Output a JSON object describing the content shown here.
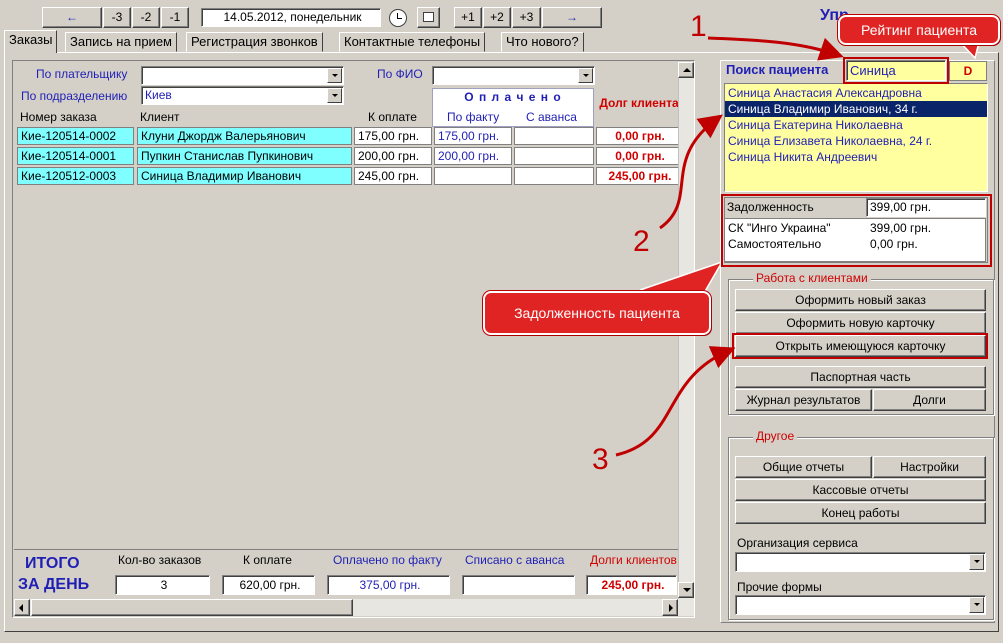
{
  "toolbar": {
    "prev_arrow": "←",
    "minus3": "-3",
    "minus2": "-2",
    "minus1": "-1",
    "date": "14.05.2012, понедельник",
    "plus1": "+1",
    "plus2": "+2",
    "plus3": "+3",
    "next_arrow": "→",
    "title_fragment": "Упр"
  },
  "tabs": [
    "Заказы",
    "Запись на прием",
    "Регистрация звонков",
    "Контактные телефоны",
    "Что нового?"
  ],
  "filters": {
    "payer_label": "По плательщику",
    "payer_value": "",
    "fio_label": "По ФИО",
    "fio_value": "",
    "division_label": "По подразделению",
    "division_value": "Киев"
  },
  "table": {
    "headers": {
      "order_no": "Номер заказа",
      "client": "Клиент",
      "to_pay": "К оплате",
      "paid_group": "О п л а ч е н о",
      "paid_fact": "По факту",
      "paid_advance": "С аванса",
      "debt": "Долг клиента"
    },
    "rows": [
      {
        "order_no": "Кие-120514-0002",
        "client": "Клуни Джордж Валерьянович",
        "to_pay": "175,00 грн.",
        "paid_fact": "175,00 грн.",
        "paid_advance": "",
        "debt": "0,00 грн."
      },
      {
        "order_no": "Кие-120514-0001",
        "client": "Пупкин Станислав Пупкинович",
        "to_pay": "200,00 грн.",
        "paid_fact": "200,00 грн.",
        "paid_advance": "",
        "debt": "0,00 грн."
      },
      {
        "order_no": "Кие-120512-0003",
        "client": "Синица Владимир Иванович",
        "to_pay": "245,00 грн.",
        "paid_fact": "",
        "paid_advance": "",
        "debt": "245,00 грн."
      }
    ]
  },
  "totals": {
    "title_line1": "ИТОГО",
    "title_line2": "ЗА ДЕНЬ",
    "count_label": "Кол-во заказов",
    "count_value": "3",
    "to_pay_label": "К оплате",
    "to_pay_value": "620,00 грн.",
    "paid_label": "Оплачено по факту",
    "paid_value": "375,00 грн.",
    "advance_label": "Списано с аванса",
    "advance_value": "",
    "debt_label": "Долги клиентов",
    "debt_value": "245,00 грн."
  },
  "patient_search": {
    "label": "Поиск пациента",
    "value": "Синица",
    "rating": "D",
    "results": [
      "Синица Анастасия Александровна",
      "Синица Владимир Иванович, 34 г.",
      "Синица Екатерина Николаевна",
      "Синица Елизавета Николаевна, 24 г.",
      "Синица Никита Андреевич"
    ],
    "selected_index": 1
  },
  "debt": {
    "label": "Задолженность",
    "total": "399,00 грн.",
    "items": [
      {
        "name": "СК \"Инго Украина\"",
        "amount": "399,00 грн."
      },
      {
        "name": "Самостоятельно",
        "amount": "0,00 грн."
      }
    ]
  },
  "clients_group": {
    "title": "Работа с клиентами",
    "new_order": "Оформить новый заказ",
    "new_card": "Оформить новую карточку",
    "open_card": "Открыть имеющуюся карточку",
    "passport": "Паспортная часть",
    "results_log": "Журнал результатов",
    "debts": "Долги"
  },
  "other_group": {
    "title": "Другое",
    "general_reports": "Общие отчеты",
    "settings": "Настройки",
    "cash_reports": "Кассовые отчеты",
    "end_work": "Конец работы",
    "service_org_label": "Организация сервиса",
    "service_org_value": "",
    "other_forms_label": "Прочие формы",
    "other_forms_value": ""
  },
  "annotations": {
    "callout_rating": "Рейтинг пациента",
    "callout_debt": "Задолженность пациента",
    "num1": "1",
    "num2": "2",
    "num3": "3"
  },
  "colors": {
    "accent_red": "#c00000",
    "link_blue": "#1f1fb5",
    "cyan_cell": "#7fffff",
    "search_list_bg": "#ffffa0"
  }
}
